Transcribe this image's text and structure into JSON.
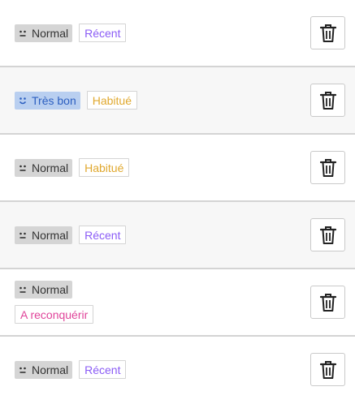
{
  "colors": {
    "recent": "#8b5cf6",
    "habitue": "#e0a82e",
    "reconquerir": "#e0449a",
    "mood_normal_bg": "#d5d5d5",
    "mood_good_bg": "#b9cff0"
  },
  "icons": {
    "mood_normal": "neutral-face-icon",
    "mood_good": "smiling-face-icon",
    "delete": "trash-icon"
  },
  "rows": [
    {
      "mood": "Normal",
      "tag": "Récent"
    },
    {
      "mood": "Très bon",
      "tag": "Habitué"
    },
    {
      "mood": "Normal",
      "tag": "Habitué"
    },
    {
      "mood": "Normal",
      "tag": "Récent"
    },
    {
      "mood": "Normal",
      "tag": "A reconquérir"
    },
    {
      "mood": "Normal",
      "tag": "Récent"
    }
  ]
}
